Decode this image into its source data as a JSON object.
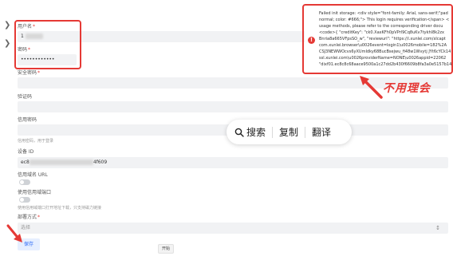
{
  "form": {
    "username": {
      "label": "用户名",
      "required_mark": "*",
      "value_prefix": "1"
    },
    "password": {
      "label": "密码",
      "required_mark": "*",
      "value": "••••••••••••"
    },
    "security_password": {
      "label": "安全密码",
      "required_mark": "*"
    },
    "captcha": {
      "label": "验证码"
    },
    "credit_password": {
      "label": "信用密码",
      "hint": "信用密码，用于登录"
    },
    "device_id": {
      "label": "设备 ID",
      "value_prefix": "ec8",
      "value_suffix": "4f609"
    },
    "credit_domain_url": {
      "label": "信用域名 URL"
    },
    "credit_domain_port": {
      "label": "使用信用域端口",
      "hint": "使用信用域端口打开地址下载，只支持磁力链接"
    },
    "deploy_mode": {
      "label": "部署方式",
      "required_mark": "*",
      "placeholder": "选择"
    }
  },
  "buttons": {
    "save": "保存",
    "start": "开始"
  },
  "context_toolbar": {
    "search": "搜索",
    "copy": "复制",
    "translate": "翻译"
  },
  "error_message": {
    "lines": [
      "Failed init storage: <div style=\"font-family: Arial, sans-serif;\"pad",
      "normal; color: #666;\"> This login requires verification</span> <",
      "usage methods, please refer to the corresponding driver docu",
      "<code>{ \"creditKey\": \"ck0.XaxKFh0pVPrl9Cq8uKv7tykhl8k2zx",
      "Bnria8a665VFpsSO_w\", \"reviewurl\": \"https://i.xunlei.com/xlcapt",
      "com.xunlei.browser\\u0026event=login1\\u0026mobile=182%2A",
      "CSJ3NEWWOcvs6yXUmIdky68BucBsejwu_fi48w1Wvytj JYt6cYCk14",
      "ssl.xunlei.com\\u0026providerName=NONE\\u0026appid=22062",
      "\"dixf01.ec8c8c68aace9500a1c27dd2b430f6609b8fa3a0e5157b142"
    ]
  },
  "annotation": "不用理会",
  "colors": {
    "accent": "#2f6cf6",
    "danger": "#e53935",
    "field_bg": "#f1f2f4"
  }
}
